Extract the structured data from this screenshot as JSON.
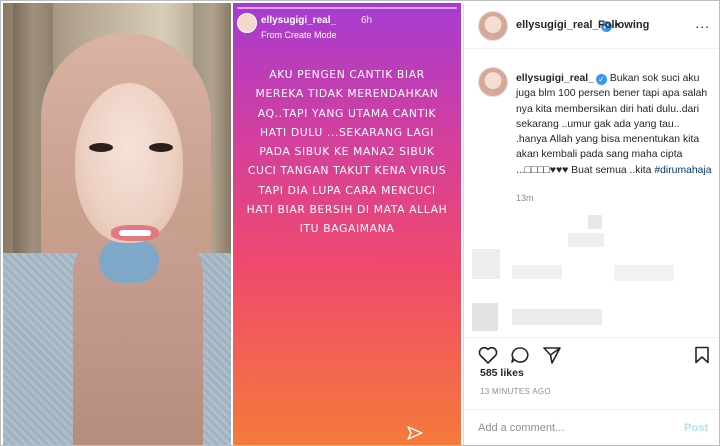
{
  "story": {
    "username": "ellysugigi_real_",
    "time": "6h",
    "mode": "From Create Mode",
    "text": "AKU PENGEN CANTIK BIAR\nMEREKA TIDAK MERENDAHKAN\nAQ..TAPI YANG UTAMA CANTIK\nHATI DULU ...SEKARANG LAGI\nPADA SIBUK KE MANA2 SIBUK\nCUCI TANGAN TAKUT KENA VIRUS\nTAPI DIA LUPA CARA MENCUCI\nHATI BIAR BERSIH  DI MATA ALLAH\nITU BAGAIMANA"
  },
  "post": {
    "header": {
      "username": "ellysugigi_real_",
      "separator": "•",
      "follow_label": "Following",
      "more_label": "..."
    },
    "caption": {
      "username": "ellysugigi_real_",
      "text": "Bukan sok suci aku juga blm 100 persen bener tapi apa salah nya kita membersikan diri hati dulu..dari sekarang ..umur gak ada yang tau.. .hanya Allah yang bisa menentukan kita akan kembali pada sang maha cipta ...",
      "emoji": "□□□□♥♥♥",
      "text2": " Buat semua ..kita ",
      "hashtag": "#dirumahaja",
      "ago": "13m"
    },
    "likes": "585 likes",
    "timestamp": "13 MINUTES AGO",
    "comment_placeholder": "Add a comment...",
    "post_label": "Post",
    "icons": [
      "heart-icon",
      "comment-icon",
      "share-icon",
      "bookmark-icon"
    ],
    "colors": {
      "link": "#00376b",
      "verified": "#3897f0",
      "post_button": "#b2dffc"
    }
  }
}
